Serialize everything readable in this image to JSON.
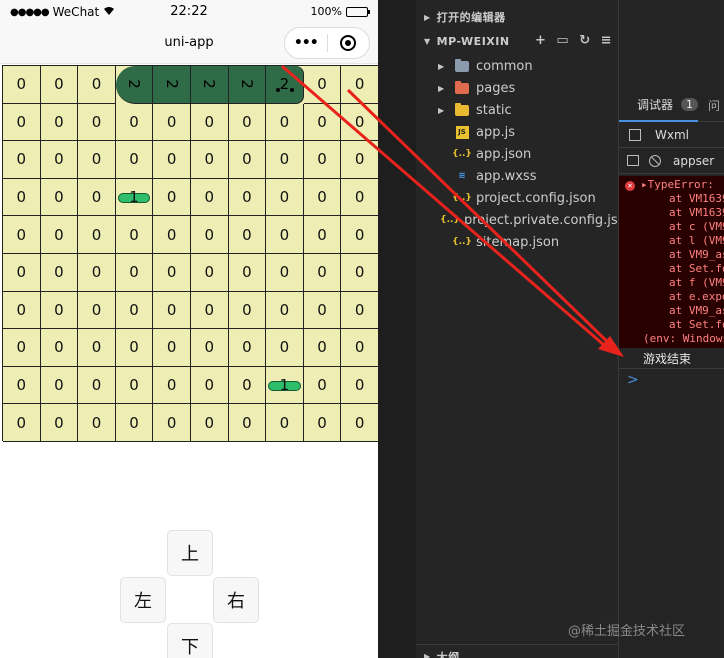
{
  "phone": {
    "status": {
      "carrier": "WeChat",
      "time": "22:22",
      "battery": "100%",
      "battery_level": 1.0
    },
    "nav_title": "uni-app",
    "grid": [
      [
        "0",
        "0",
        "0",
        "2",
        "2",
        "2",
        "2",
        "2",
        "0",
        "0"
      ],
      [
        "0",
        "0",
        "0",
        "0",
        "0",
        "0",
        "0",
        "0",
        "0",
        "0"
      ],
      [
        "0",
        "0",
        "0",
        "0",
        "0",
        "0",
        "0",
        "0",
        "0",
        "0"
      ],
      [
        "0",
        "0",
        "0",
        "1",
        "0",
        "0",
        "0",
        "0",
        "0",
        "0"
      ],
      [
        "0",
        "0",
        "0",
        "0",
        "0",
        "0",
        "0",
        "0",
        "0",
        "0"
      ],
      [
        "0",
        "0",
        "0",
        "0",
        "0",
        "0",
        "0",
        "0",
        "0",
        "0"
      ],
      [
        "0",
        "0",
        "0",
        "0",
        "0",
        "0",
        "0",
        "0",
        "0",
        "0"
      ],
      [
        "0",
        "0",
        "0",
        "0",
        "0",
        "0",
        "0",
        "0",
        "0",
        "0"
      ],
      [
        "0",
        "0",
        "0",
        "0",
        "0",
        "0",
        "0",
        "1",
        "0",
        "0"
      ],
      [
        "0",
        "0",
        "0",
        "0",
        "0",
        "0",
        "0",
        "0",
        "0",
        "0"
      ]
    ],
    "buttons": {
      "up": "上",
      "left": "左",
      "right": "右",
      "down": "下"
    }
  },
  "explorer": {
    "open_editors": "打开的编辑器",
    "project": "MP-WEIXIN",
    "files": [
      {
        "name": "common",
        "type": "folder",
        "color": "#8c9aad"
      },
      {
        "name": "pages",
        "type": "folder",
        "color": "#e06c4f"
      },
      {
        "name": "static",
        "type": "folder",
        "color": "#e8b931"
      },
      {
        "name": "app.js",
        "type": "js"
      },
      {
        "name": "app.json",
        "type": "json"
      },
      {
        "name": "app.wxss",
        "type": "wxss"
      },
      {
        "name": "project.config.json",
        "type": "json"
      },
      {
        "name": "project.private.config.js...",
        "type": "json"
      },
      {
        "name": "sitemap.json",
        "type": "json"
      }
    ],
    "outline": "大纲"
  },
  "debugger": {
    "tab_label": "调试器",
    "badge": "1",
    "tab2_label": "问",
    "wxml_tab": "Wxml",
    "context": "appser",
    "error_lines": [
      "TypeError:",
      "at VM1639",
      "at VM1639",
      "at c (VM9",
      "at l (VM9",
      "at VM9_as",
      "at Set.fo",
      "at f (VM9",
      "at e.expo",
      "at VM9_as",
      "at Set.fo",
      "(env: Windows"
    ],
    "log": "游戏结束",
    "prompt": ">"
  },
  "watermark": "@稀土掘金技术社区"
}
